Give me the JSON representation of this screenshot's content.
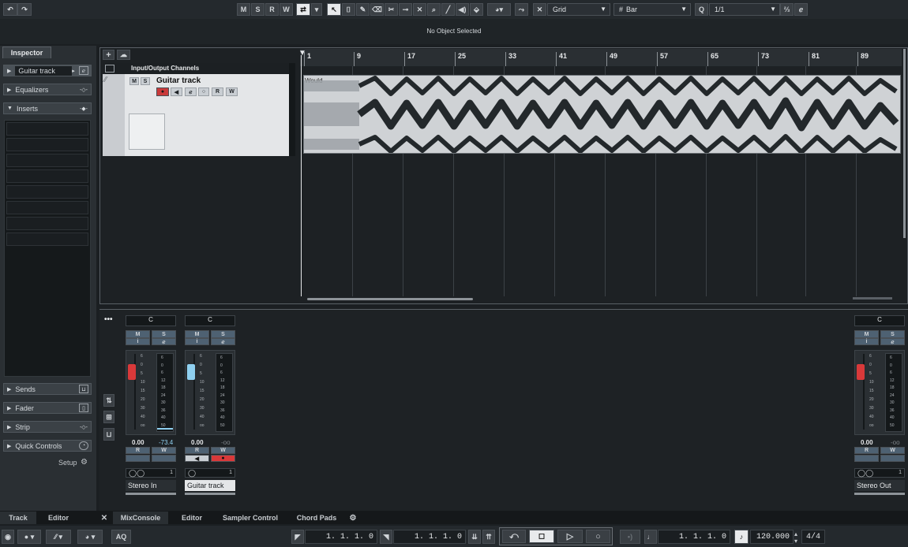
{
  "toolbar": {
    "undo_icon": "undo-icon",
    "redo_icon": "redo-icon",
    "mute_label": "M",
    "solo_label": "S",
    "read_label": "R",
    "write_label": "W",
    "snap_type": "Grid",
    "grid_type": "Bar",
    "quantize_value": "1/1"
  },
  "infoline": {
    "status": "No Object Selected"
  },
  "inspector": {
    "tab_label": "Inspector",
    "track_name": "Guitar track",
    "sections": [
      "Equalizers",
      "Inserts",
      "Sends",
      "Fader",
      "Strip",
      "Quick Controls"
    ],
    "setup_label": "Setup"
  },
  "project": {
    "folder_title": "Input/Output Channels",
    "track_name": "Guitar track",
    "mute_label": "M",
    "solo_label": "S",
    "read_label": "R",
    "write_label": "W",
    "clip_name": "Would",
    "ruler_marks": [
      "1",
      "9",
      "17",
      "25",
      "33",
      "41",
      "49",
      "57",
      "65",
      "73",
      "81",
      "89"
    ]
  },
  "mixer": {
    "strips": [
      {
        "name": "Stereo In",
        "pan": "C",
        "fader_value": "0.00",
        "meter_value": "-73.4"
      },
      {
        "name": "Guitar track",
        "pan": "C",
        "fader_value": "0.00",
        "meter_value": "-oo"
      },
      {
        "name": "Stereo Out",
        "pan": "C",
        "fader_value": "0.00",
        "meter_value": "-oo"
      }
    ],
    "scale": [
      "6",
      "0",
      "5",
      "10",
      "15",
      "20",
      "30",
      "40",
      "oo"
    ],
    "meter_scale": [
      "6",
      "0",
      "6",
      "12",
      "18",
      "24",
      "30",
      "36",
      "40",
      "50"
    ],
    "channel_count": "1"
  },
  "tabs": {
    "left": [
      "Track",
      "Editor"
    ],
    "right": [
      "MixConsole",
      "Editor",
      "Sampler Control",
      "Chord Pads"
    ]
  },
  "transport": {
    "aq_label": "AQ",
    "left_locator": "1.  1.  1.    0",
    "right_locator": "1.  1.  1.    0",
    "position": "1.  1.  1.    0",
    "tempo": "120.000",
    "signature": "4/4"
  },
  "colors": {
    "accent_red": "#d9393a",
    "accent_blue": "#8fd0f0",
    "selected_tab": "#2a2f33"
  }
}
